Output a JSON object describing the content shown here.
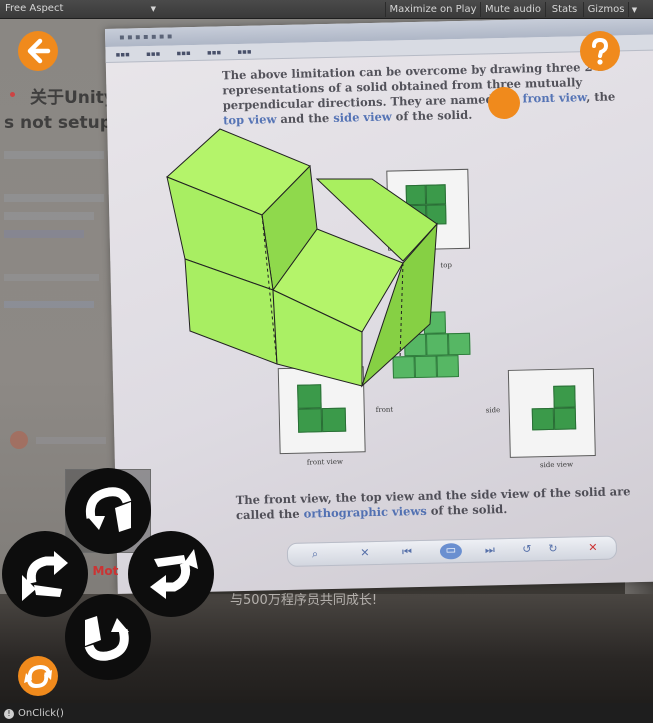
{
  "toolbar": {
    "aspect": "Free Aspect",
    "maximize": "Maximize on Play",
    "mute": "Mute audio",
    "stats": "Stats",
    "gizmos": "Gizmos"
  },
  "document": {
    "para_before": "The above limitation can be overcome by drawing three 2-D representations of a solid obtained from three mutually perpendicular directions. They are named the",
    "front_view_link": "front view",
    "the_text": ", the",
    "top_view_link": "top view",
    "and_the": " and the",
    "side_view_link": "side view",
    "para_end": " of the solid.",
    "front_view_label": "front view",
    "side_view_label": "side view",
    "top_label": "top",
    "front_arrow_label": "front",
    "side_arrow_label": "side",
    "bottom_text": "The front view, the top view and the side view of the solid are called the",
    "ortho_link": "orthographic views",
    "bottom_end": " of the solid."
  },
  "background_page": {
    "title": "关于Unity",
    "subtitle": "s not setup",
    "bottom_cn": "与500万程序员共同成长!",
    "axis_label": "Axis Mot"
  },
  "onclick_label": "OnClick()",
  "colors": {
    "accent": "#f08a1c",
    "cube_face_front": "#a8f060",
    "control_bg": "#0d0d0d"
  },
  "icons": {
    "back": "arrow-left-icon",
    "help": "question-mark-icon",
    "reset": "refresh-icon",
    "rotate_down": "rotate-down-icon",
    "rotate_left": "rotate-left-icon",
    "rotate_right": "rotate-right-icon",
    "rotate_up": "rotate-up-icon"
  }
}
